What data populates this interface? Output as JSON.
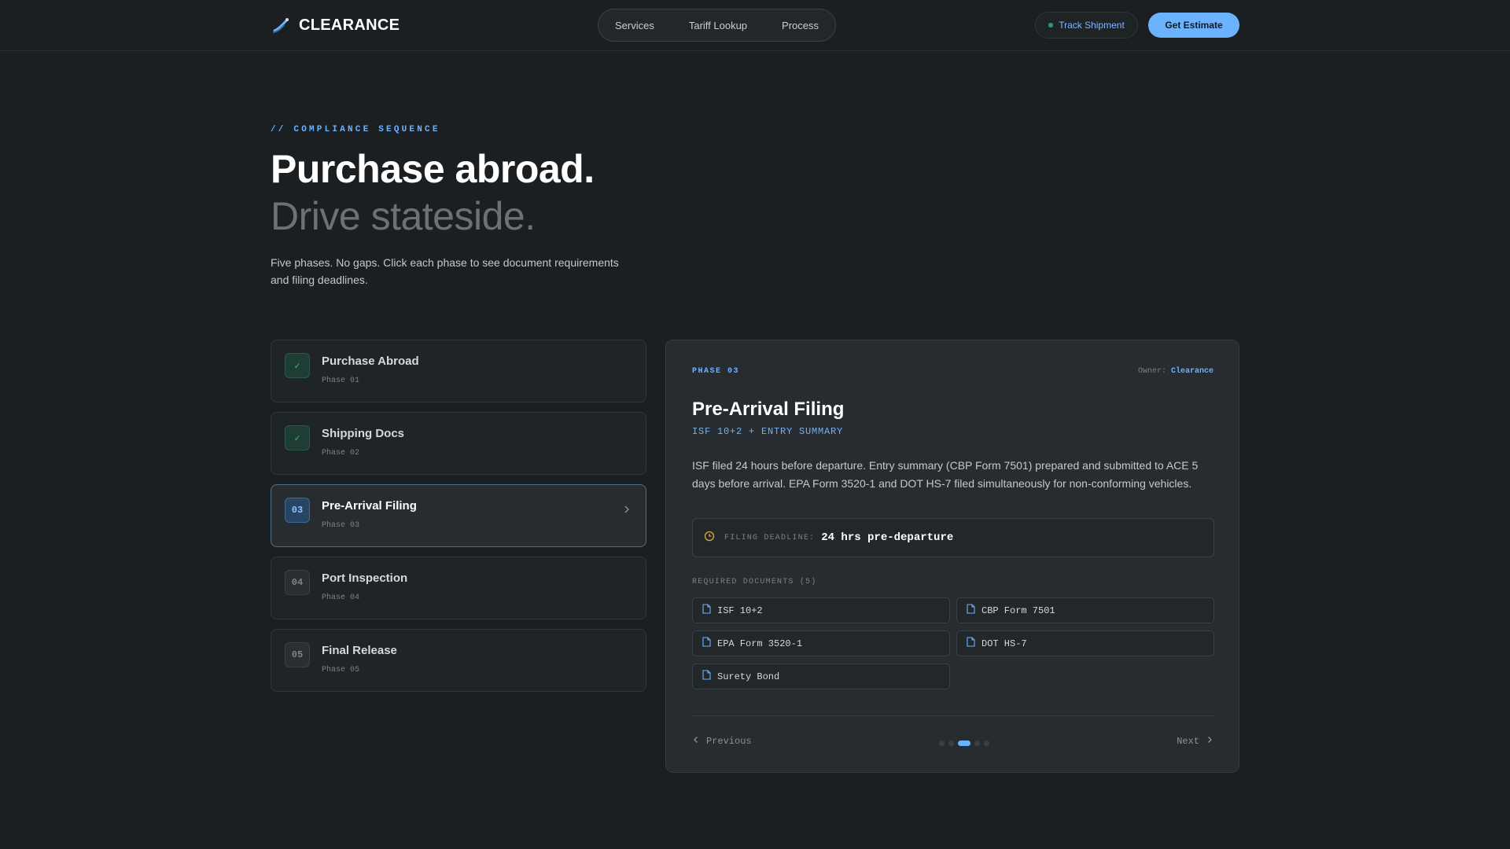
{
  "brand": {
    "name": "CLEARANCE",
    "icon": "ship-wake-icon"
  },
  "nav": {
    "links": [
      "Services",
      "Tariff Lookup",
      "Process"
    ],
    "track_label": "Track Shipment",
    "estimate_label": "Get Estimate"
  },
  "hero": {
    "eyebrow": "// COMPLIANCE SEQUENCE",
    "title_line1": "Purchase abroad.",
    "title_line2": "Drive stateside.",
    "intro": "Five phases. No gaps. Click each phase to see document requirements and filing deadlines."
  },
  "phases": [
    {
      "badge": "✓",
      "state": "done",
      "title": "Purchase Abroad",
      "sub": "Phase 01"
    },
    {
      "badge": "✓",
      "state": "done",
      "title": "Shipping Docs",
      "sub": "Phase 02"
    },
    {
      "badge": "03",
      "state": "current",
      "title": "Pre-Arrival Filing",
      "sub": "Phase 03"
    },
    {
      "badge": "04",
      "state": "pending",
      "title": "Port Inspection",
      "sub": "Phase 04"
    },
    {
      "badge": "05",
      "state": "pending",
      "title": "Final Release",
      "sub": "Phase 05"
    }
  ],
  "detail": {
    "phase_tag": "PHASE 03",
    "owner_label": "Owner:",
    "owner_value": "Clearance",
    "title": "Pre-Arrival Filing",
    "subtitle": "ISF 10+2 + ENTRY SUMMARY",
    "description": "ISF filed 24 hours before departure. Entry summary (CBP Form 7501) prepared and submitted to ACE 5 days before arrival. EPA Form 3520-1 and DOT HS-7 filed simultaneously for non-conforming vehicles.",
    "deadline_label": "FILING DEADLINE:",
    "deadline_value": "24 hrs pre-departure",
    "docs_label": "REQUIRED DOCUMENTS (5)",
    "docs": [
      "ISF 10+2",
      "CBP Form 7501",
      "EPA Form 3520-1",
      "DOT HS-7",
      "Surety Bond"
    ],
    "prev_label": "Previous",
    "next_label": "Next",
    "current_index": 3,
    "total": 5
  },
  "colors": {
    "accent": "#6cb3ff",
    "done": "#3fb98b",
    "deadline_icon": "#e0a83a"
  }
}
